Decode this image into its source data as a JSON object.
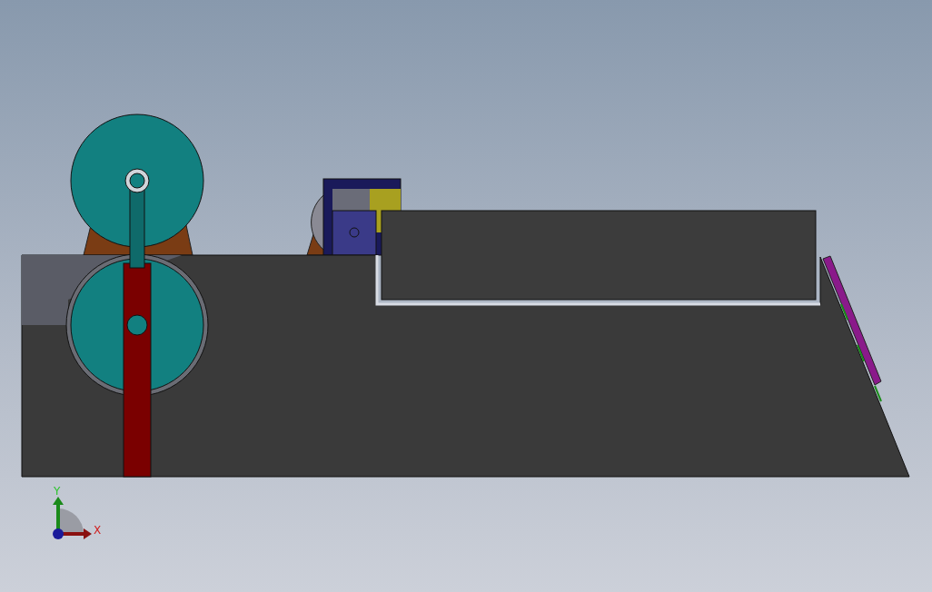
{
  "viewport": {
    "triad": {
      "y_label": "Y",
      "x_label": "X"
    }
  }
}
